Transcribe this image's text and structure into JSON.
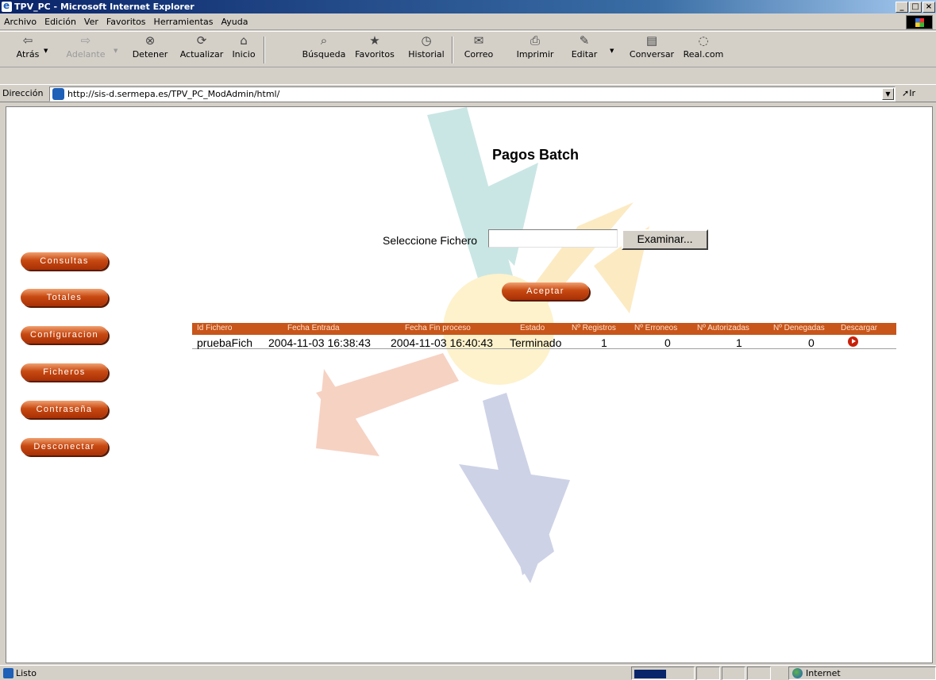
{
  "window": {
    "title": "TPV_PC - Microsoft Internet Explorer"
  },
  "menu": [
    "Archivo",
    "Edición",
    "Ver",
    "Favoritos",
    "Herramientas",
    "Ayuda"
  ],
  "toolbar": {
    "back": "Atrás",
    "forward": "Adelante",
    "stop": "Detener",
    "refresh": "Actualizar",
    "home": "Inicio",
    "search": "Búsqueda",
    "favorites": "Favoritos",
    "history": "Historial",
    "mail": "Correo",
    "print": "Imprimir",
    "edit": "Editar",
    "discuss": "Conversar",
    "realcom": "Real.com"
  },
  "address": {
    "label": "Dirección",
    "url": "http://sis-d.sermepa.es/TPV_PC_ModAdmin/html/",
    "go": "Ir"
  },
  "page": {
    "title": "Pagos Batch",
    "file_label": "Seleccione Fichero",
    "file_value": "",
    "browse": "Examinar...",
    "accept": "Aceptar"
  },
  "nav": [
    "Consultas",
    "Totales",
    "Configuracion",
    "Ficheros",
    "Contraseña",
    "Desconectar"
  ],
  "table": {
    "headers": [
      "Id Fichero",
      "Fecha Entrada",
      "Fecha Fin proceso",
      "Estado",
      "Nº Registros",
      "Nº Erroneos",
      "Nº Autorizadas",
      "Nº Denegadas",
      "Descargar"
    ],
    "rows": [
      [
        "pruebaFich",
        "2004-11-03 16:38:43",
        "2004-11-03 16:40:43",
        "Terminado",
        "1",
        "0",
        "1",
        "0"
      ]
    ]
  },
  "status": {
    "text": "Listo",
    "zone": "Internet"
  },
  "colors": {
    "accent": "#c8551a",
    "title_bar": "#0a246a"
  }
}
